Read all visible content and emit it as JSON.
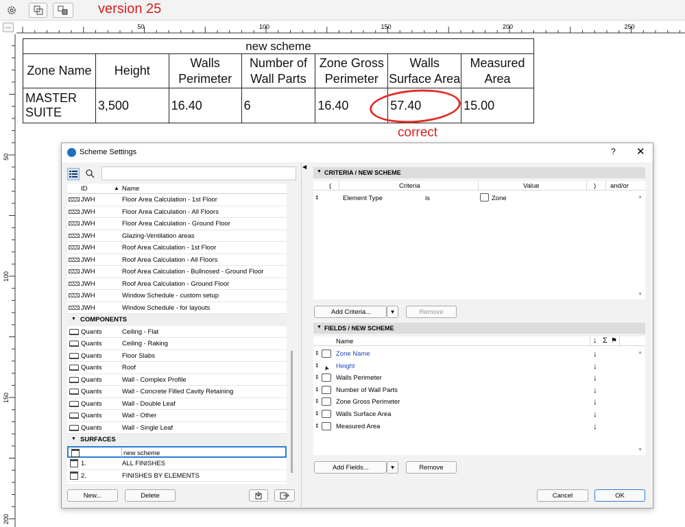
{
  "toolbar": {
    "settings_icon": "gear-icon",
    "btn1_icon": "select-icon",
    "btn2_icon": "transfer-icon",
    "version_label": "version 25"
  },
  "ruler": {
    "corner": "...",
    "h_labels": [
      "50",
      "100",
      "150",
      "200",
      "250"
    ],
    "v_labels": [
      "50",
      "100",
      "150",
      "200"
    ]
  },
  "schedule": {
    "title": "new scheme",
    "headers": [
      "Zone Name",
      "Height",
      "Walls Perimeter",
      "Number of Wall Parts",
      "Zone Gross Perimeter",
      "Walls Surface Area",
      "Measured Area"
    ],
    "row": [
      "MASTER SUITE",
      "3,500",
      "16.40",
      "6",
      "16.40",
      "57.40",
      "15.00"
    ],
    "annotation": "correct",
    "highlight_color": "#e0302a"
  },
  "dialog": {
    "title": "Scheme Settings",
    "help": "?",
    "close": "✕",
    "list_headers": {
      "id": "ID",
      "name": "Name"
    },
    "items": [
      {
        "id": "JWH",
        "name": "Floor Area Calculation - 1st Floor"
      },
      {
        "id": "JWH",
        "name": "Floor Area Calculation - All Floors"
      },
      {
        "id": "JWH",
        "name": "Floor Area Calculation - Ground Floor"
      },
      {
        "id": "JWH",
        "name": "Glazing-Ventilation areas"
      },
      {
        "id": "JWH",
        "name": "Roof Area Calculation - 1st Floor"
      },
      {
        "id": "JWH",
        "name": "Roof Area Calculation - All Floors"
      },
      {
        "id": "JWH",
        "name": "Roof Area Calculation - Bullnosed - Ground Floor"
      },
      {
        "id": "JWH",
        "name": "Roof Area Calculation - Ground Floor"
      },
      {
        "id": "JWH",
        "name": "Window Schedule - custom setup"
      },
      {
        "id": "JWH",
        "name": "Window Schedule - for layouts"
      }
    ],
    "group_components": "COMPONENTS",
    "components": [
      {
        "id": "Quants",
        "name": "Ceiling - Flat"
      },
      {
        "id": "Quants",
        "name": "Ceiling - Raking"
      },
      {
        "id": "Quants",
        "name": "Floor Slabs"
      },
      {
        "id": "Quants",
        "name": "Roof"
      },
      {
        "id": "Quants",
        "name": "Wall - Complex Profile"
      },
      {
        "id": "Quants",
        "name": "Wall - Concrete Filled Cavity Retaining"
      },
      {
        "id": "Quants",
        "name": "Wall - Double Leaf"
      },
      {
        "id": "Quants",
        "name": "Wall - Other"
      },
      {
        "id": "Quants",
        "name": "Wall - Single Leaf"
      }
    ],
    "group_surfaces": "SURFACES",
    "surfaces": [
      {
        "id": "",
        "name": "new scheme"
      },
      {
        "id": "1.",
        "name": "ALL FINISHES"
      },
      {
        "id": "2.",
        "name": "FINISHES BY ELEMENTS"
      }
    ],
    "new_button": "New...",
    "delete_button": "Delete",
    "criteria": {
      "section_title": "CRITERIA /  NEW SCHEME",
      "col_open": "(",
      "col_criteria": "Criteria",
      "col_value": "Value",
      "col_close": ")",
      "col_andor": "and/or",
      "row_type": "Element Type",
      "row_op": "is",
      "row_value": "Zone",
      "add_button": "Add Criteria...",
      "remove_button": "Remove"
    },
    "fields": {
      "section_title": "FIELDS /  NEW SCHEME",
      "col_name": "Name",
      "items": [
        "Zone Name",
        "Height",
        "Walls Perimeter",
        "Number of Wall Parts",
        "Zone Gross Perimeter",
        "Walls Surface Area",
        "Measured Area"
      ],
      "add_button": "Add Fields...",
      "remove_button": "Remove"
    },
    "cancel_button": "Cancel",
    "ok_button": "OK"
  }
}
